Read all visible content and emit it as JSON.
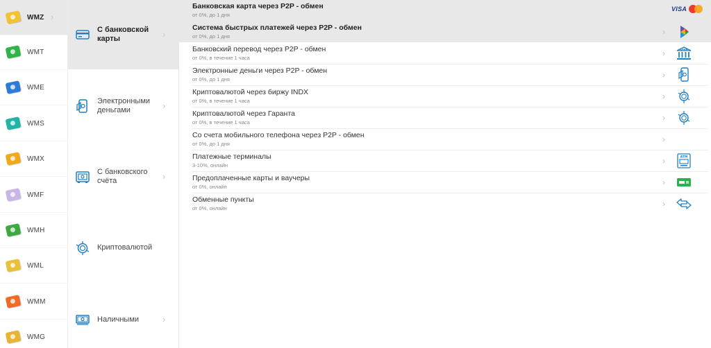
{
  "wallets": [
    {
      "label": "WMZ",
      "color": "#f2c230",
      "active": true
    },
    {
      "label": "WMT",
      "color": "#2fb34a",
      "active": false
    },
    {
      "label": "WME",
      "color": "#2e7bd6",
      "active": false
    },
    {
      "label": "WMS",
      "color": "#23b3a4",
      "active": false
    },
    {
      "label": "WMX",
      "color": "#f0a81c",
      "active": false
    },
    {
      "label": "WMF",
      "color": "#c9b6e6",
      "active": false
    },
    {
      "label": "WMH",
      "color": "#3ea843",
      "active": false
    },
    {
      "label": "WML",
      "color": "#e9c03a",
      "active": false
    },
    {
      "label": "WMM",
      "color": "#f06a2a",
      "active": false
    },
    {
      "label": "WMG",
      "color": "#e8b437",
      "active": false
    }
  ],
  "methods": [
    {
      "label": "С банковской карты",
      "icon": "bank-card-icon",
      "active": true
    },
    {
      "label": "Электронными деньгами",
      "icon": "e-money-phone-icon",
      "active": false
    },
    {
      "label": "С банковского счёта",
      "icon": "bank-vault-icon",
      "active": false
    },
    {
      "label": "Криптовалютой",
      "icon": "crypto-coin-icon",
      "active": false
    },
    {
      "label": "Наличными",
      "icon": "cash-banknote-icon",
      "active": false
    }
  ],
  "options": [
    {
      "title": "Банковская карта через P2P - обмен",
      "sub": "от 0%, до 1 дня",
      "icon": "visa-mastercard-icon",
      "bold": true
    },
    {
      "title": "Система быстрых платежей через P2P - обмен",
      "sub": "от 0%, до 1 дня",
      "icon": "sbp-icon",
      "bold": true
    },
    {
      "title": "Банковский перевод через P2P - обмен",
      "sub": "от 0%, в течение 1 часа",
      "icon": "bank-building-icon",
      "bank_text": "БАНК",
      "bold": false
    },
    {
      "title": "Электронные деньги через P2P - обмен",
      "sub": "от 0%, до 1 дня",
      "icon": "e-money-phone-icon",
      "bold": false
    },
    {
      "title": "Криптовалютой через биржу INDX",
      "sub": "от 0%, в течение 1 часа",
      "icon": "crypto-coin-icon",
      "bold": false
    },
    {
      "title": "Криптовалютой через Гаранта",
      "sub": "от 0%, в течение 1 часа",
      "icon": "crypto-coin-icon",
      "bold": false
    },
    {
      "title": "Со счета мобильного телефона через P2P - обмен",
      "sub": "от 0%, до 1 дня",
      "icon": "",
      "bold": false
    },
    {
      "title": "Платежные терминалы",
      "sub": "3-10%, онлайн",
      "icon": "atm-terminal-icon",
      "atm_text": "ATM",
      "bold": false
    },
    {
      "title": "Предоплаченные карты и ваучеры",
      "sub": "от 0%, онлайн",
      "icon": "prepaid-card-icon",
      "bold": false
    },
    {
      "title": "Обменные пункты",
      "sub": "от 0%, онлайн",
      "icon": "exchange-arrows-icon",
      "bold": false
    }
  ],
  "brand": {
    "visa": "VISA"
  },
  "colors": {
    "accent": "#1f7fc4",
    "active_bg": "#e8e8e8"
  }
}
